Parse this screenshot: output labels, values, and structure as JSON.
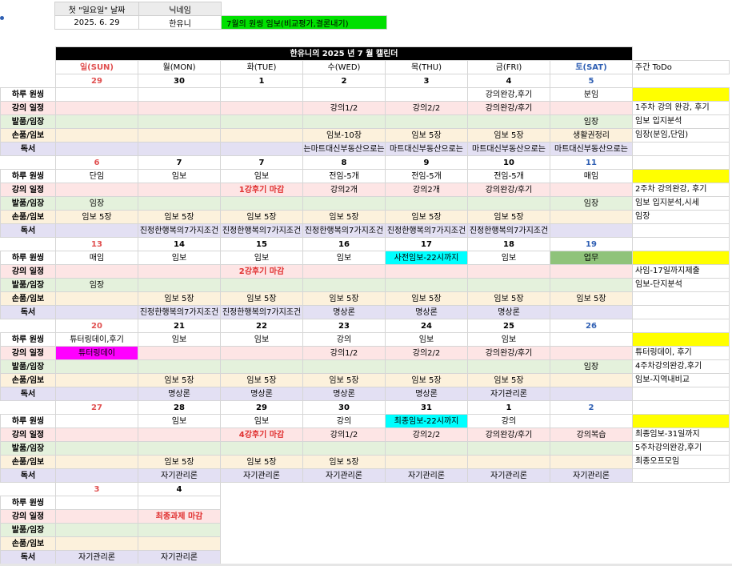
{
  "header": {
    "label_first_sunday": "첫 \"일요일\" 날짜",
    "label_nickname": "닉네임",
    "first_sunday": "2025. 6. 29",
    "nickname": "한유니",
    "monthly_goal": "7월의 원씽  임보(비교평가,결론내기)"
  },
  "calendar": {
    "title": "한유니의 2025 년 7 월 캘린더",
    "weekdays": [
      "일(SUN)",
      "월(MON)",
      "화(TUE)",
      "수(WED)",
      "목(THU)",
      "금(FRI)",
      "토(SAT)"
    ],
    "todo_header": "주간 ToDo",
    "row_labels": [
      "하루 원씽",
      "강의 일정",
      "발품/임장",
      "손품/임보",
      "독서"
    ],
    "weeks": [
      {
        "dates": [
          "29",
          "30",
          "1",
          "2",
          "3",
          "4",
          "5"
        ],
        "rows": [
          [
            "",
            "",
            "",
            "",
            "",
            "강의완강,후기",
            "분임"
          ],
          [
            "",
            "",
            "",
            "강의1/2",
            "강의2/2",
            "강의완강/후기",
            ""
          ],
          [
            "",
            "",
            "",
            "",
            "",
            "",
            "임장"
          ],
          [
            "",
            "",
            "",
            "임보-10장",
            "임보 5장",
            "임보 5장",
            "생활권정리"
          ],
          [
            "",
            "",
            "",
            "는마트대신부동산으로는",
            "마트대신부동산으로는",
            "마트대신부동산으로는",
            "마트대신부동산으로는"
          ]
        ],
        "todo": [
          "",
          "1주차 강의 완강, 후기",
          "임보 입지분석",
          "임장(분임,단임)"
        ]
      },
      {
        "dates": [
          "6",
          "7",
          "7",
          "8",
          "9",
          "10",
          "11"
        ],
        "rows": [
          [
            "단임",
            "임보",
            "임보",
            "전임-5개",
            "전임-5개",
            "전임-5개",
            "매임"
          ],
          [
            "",
            "",
            "1강후기 마감",
            "강의2개",
            "강의2개",
            "강의완강/후기",
            ""
          ],
          [
            "임장",
            "",
            "",
            "",
            "",
            "",
            "임장"
          ],
          [
            "임보 5장",
            "임보 5장",
            "임보 5장",
            "임보 5장",
            "임보 5장",
            "임보 5장",
            ""
          ],
          [
            "",
            "진정한행복의7가지조건",
            "진정한행복의7가지조건",
            "진정한행복의7가지조건",
            "진정한행복의7가지조건",
            "진정한행복의7가지조건",
            ""
          ]
        ],
        "todo": [
          "",
          "2주차 강의완강, 후기",
          "임보 입지분석,시세",
          "임장"
        ]
      },
      {
        "dates": [
          "13",
          "14",
          "15",
          "16",
          "17",
          "18",
          "19"
        ],
        "rows": [
          [
            "매임",
            "임보",
            "임보",
            "임보",
            "사전임보-22시까지",
            "임보",
            "업무"
          ],
          [
            "",
            "",
            "2강후기 마감",
            "",
            "",
            "",
            ""
          ],
          [
            "임장",
            "",
            "",
            "",
            "",
            "",
            ""
          ],
          [
            "",
            "임보 5장",
            "임보 5장",
            "임보 5장",
            "임보 5장",
            "임보 5장",
            "임보 5장"
          ],
          [
            "",
            "진정한행복의7가지조건",
            "진정한행복의7가지조건",
            "명상론",
            "명상론",
            "명상론",
            ""
          ]
        ],
        "todo": [
          "",
          "사임-17일까지제출",
          "임보-단지분석",
          ""
        ]
      },
      {
        "dates": [
          "20",
          "21",
          "22",
          "23",
          "24",
          "25",
          "26"
        ],
        "rows": [
          [
            "튜터링데이,후기",
            "임보",
            "임보",
            "강의",
            "임보",
            "임보",
            ""
          ],
          [
            "튜터링데이",
            "",
            "",
            "강의1/2",
            "강의2/2",
            "강의완강/후기",
            ""
          ],
          [
            "",
            "",
            "",
            "",
            "",
            "",
            "임장"
          ],
          [
            "",
            "임보 5장",
            "임보 5장",
            "임보 5장",
            "임보 5장",
            "임보 5장",
            ""
          ],
          [
            "",
            "명상론",
            "명상론",
            "명상론",
            "명상론",
            "자기관리론",
            ""
          ]
        ],
        "todo": [
          "",
          "튜터링데이, 후기",
          "4주차강의완강,후기",
          "임보-지역내비교"
        ]
      },
      {
        "dates": [
          "27",
          "28",
          "29",
          "30",
          "31",
          "1",
          "2"
        ],
        "rows": [
          [
            "",
            "임보",
            "임보",
            "강의",
            "최종임보-22시까지",
            "강의",
            ""
          ],
          [
            "",
            "",
            "4강후기 마감",
            "강의1/2",
            "강의2/2",
            "강의완강/후기",
            "강의복습"
          ],
          [
            "",
            "",
            "",
            "",
            "",
            "",
            ""
          ],
          [
            "",
            "임보 5장",
            "임보 5장",
            "임보 5장",
            "",
            "",
            ""
          ],
          [
            "",
            "자기관리론",
            "자기관리론",
            "자기관리론",
            "자기관리론",
            "자기관리론",
            "자기관리론"
          ]
        ],
        "todo": [
          "",
          "최종임보-31일까지",
          "5주차강의완강,후기",
          "최종오프모임"
        ]
      },
      {
        "dates": [
          "3",
          "4"
        ],
        "rows": [
          [
            "",
            ""
          ],
          [
            "",
            "최종과제 마감"
          ],
          [
            "",
            ""
          ],
          [
            "",
            ""
          ],
          [
            "자기관리론",
            "자기관리론"
          ]
        ]
      }
    ]
  },
  "colors": {
    "sunday": "#e05050",
    "saturday": "#2f5fb3",
    "goal_bg": "#00e000",
    "highlight_cyan": "#00ffff",
    "highlight_magenta": "#ff00ff",
    "highlight_green": "#8fc37a",
    "todo_yellow": "#ffff00"
  }
}
